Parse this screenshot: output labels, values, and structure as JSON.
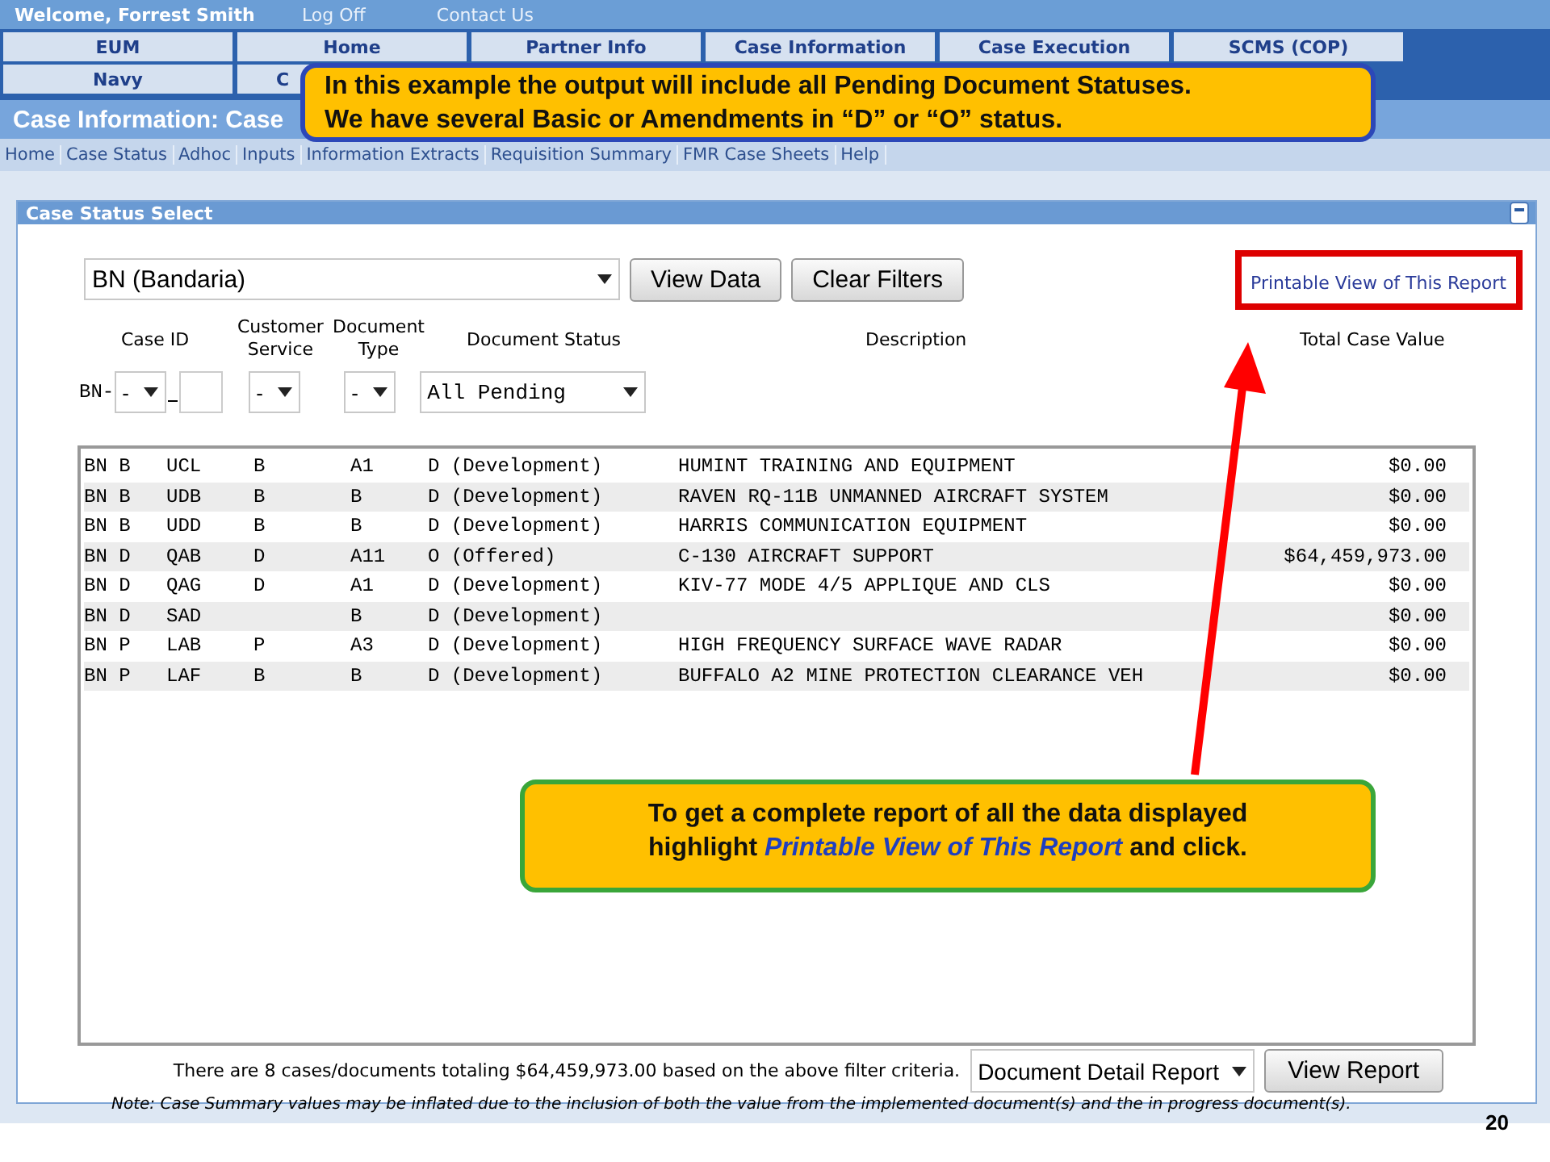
{
  "header": {
    "welcome": "Welcome, Forrest Smith",
    "links": [
      "Log Off",
      "Contact Us"
    ]
  },
  "nav_rows": [
    [
      "EUM",
      "Home",
      "Partner Info",
      "Case Information",
      "Case Execution",
      "SCMS (COP)"
    ],
    [
      "Navy",
      "C"
    ]
  ],
  "page_title": "Case Information: Case",
  "tabs": [
    "Home",
    "Case Status",
    "Adhoc",
    "Inputs",
    "Information Extracts",
    "Requisition Summary",
    "FMR Case Sheets",
    "Help"
  ],
  "panel": {
    "title": "Case Status Select",
    "country": "BN (Bandaria)",
    "buttons": [
      "View Data",
      "Clear Filters"
    ],
    "printable_link": "Printable View of This Report",
    "columns": [
      "Case ID",
      "Customer Service",
      "Document Type",
      "Document Status",
      "Description",
      "Total Case Value"
    ],
    "case_prefix": "BN-",
    "case_select": "-",
    "customer_service": "-",
    "document_type": "-",
    "document_status": "All Pending",
    "rows": [
      {
        "case": "BN B",
        "id": "UCL",
        "service": "B",
        "type": "A1",
        "status": "D (Development)",
        "description": "HUMINT TRAINING AND EQUIPMENT",
        "value": "$0.00"
      },
      {
        "case": "BN B",
        "id": "UDB",
        "service": "B",
        "type": "B",
        "status": "D (Development)",
        "description": "RAVEN RQ-11B UNMANNED AIRCRAFT SYSTEM",
        "value": "$0.00"
      },
      {
        "case": "BN B",
        "id": "UDD",
        "service": "B",
        "type": "B",
        "status": "D (Development)",
        "description": "HARRIS COMMUNICATION EQUIPMENT",
        "value": "$0.00"
      },
      {
        "case": "BN D",
        "id": "QAB",
        "service": "D",
        "type": "A11",
        "status": "O (Offered)",
        "description": "C-130 AIRCRAFT SUPPORT",
        "value": "$64,459,973.00"
      },
      {
        "case": "BN D",
        "id": "QAG",
        "service": "D",
        "type": "A1",
        "status": "D (Development)",
        "description": "KIV-77 MODE 4/5 APPLIQUE AND CLS",
        "value": "$0.00"
      },
      {
        "case": "BN D",
        "id": "SAD",
        "type": "B",
        "status": "D (Development)",
        "value": "$0.00"
      },
      {
        "case": "BN P",
        "id": "LAB",
        "service": "P",
        "type": "A3",
        "status": "D (Development)",
        "description": "HIGH FREQUENCY SURFACE WAVE RADAR",
        "value": "$0.00"
      },
      {
        "case": "BN P",
        "id": "LAF",
        "service": "B",
        "type": "B",
        "status": "D (Development)",
        "description": "BUFFALO A2 MINE PROTECTION CLEARANCE VEH",
        "value": "$0.00"
      }
    ],
    "summary": "There are 8 cases/documents totaling $64,459,973.00 based on the above filter criteria.",
    "report_type": "Document Detail Report",
    "report_button": "View Report",
    "note": "Note: Case Summary values may be inflated due to the inclusion of both the value from the implemented document(s) and the in progress document(s)."
  },
  "callouts": [
    "In this example  the output will include all Pending Document Statuses.\nWe have several Basic or  Amendments in “D” or “O” status.",
    "To get a complete report of all the data  displayed\nhighlight *Printable View of This Report* and click."
  ],
  "slide_number": "20"
}
